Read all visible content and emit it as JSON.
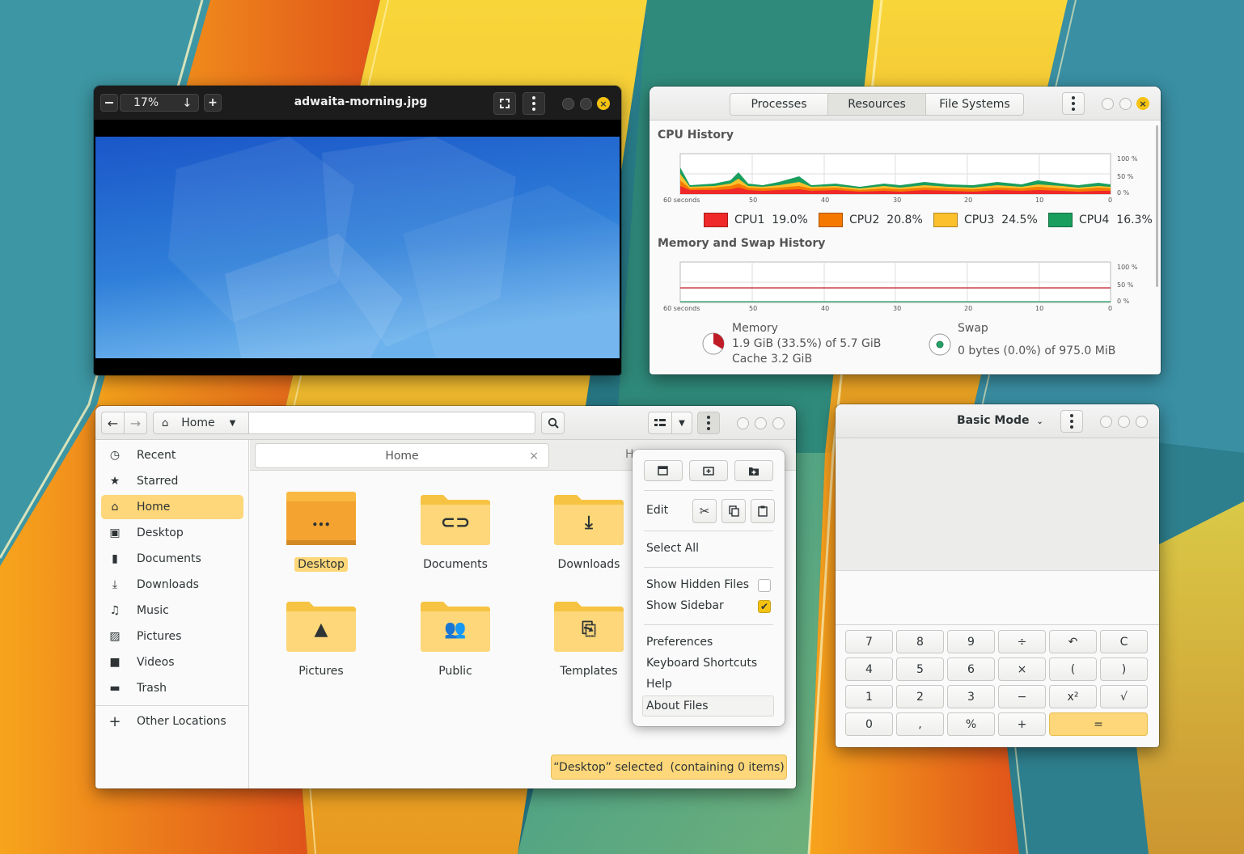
{
  "colors": {
    "accent": "#f5c211",
    "selection": "#fdd779",
    "cpu1": "#ef2929",
    "cpu2": "#f57900",
    "cpu3": "#fcc02d",
    "cpu4": "#1a9e5e",
    "memory": "#c01c28",
    "swap": "#26a269"
  },
  "viewer": {
    "zoom": "17%",
    "title": "adwaita-morning.jpg",
    "icons": {
      "zoom_out": "minus-icon",
      "zoom_menu": "arrow-down-icon",
      "zoom_in": "plus-icon",
      "fullscreen": "fullscreen-icon",
      "menu": "kebab-menu-icon",
      "close": "close-icon"
    }
  },
  "sysmon": {
    "tabs": [
      "Processes",
      "Resources",
      "File Systems"
    ],
    "active_tab": "Resources",
    "cpu": {
      "title": "CPU History",
      "yticks": [
        "100 %",
        "50 %",
        "0 %"
      ],
      "xticks": [
        "60 seconds",
        "50",
        "40",
        "30",
        "20",
        "10",
        "0"
      ],
      "legend": [
        {
          "name": "CPU1",
          "value": "19.0%"
        },
        {
          "name": "CPU2",
          "value": "20.8%"
        },
        {
          "name": "CPU3",
          "value": "24.5%"
        },
        {
          "name": "CPU4",
          "value": "16.3%"
        }
      ]
    },
    "mem": {
      "title": "Memory and Swap History",
      "yticks": [
        "100 %",
        "50 %",
        "0 %"
      ],
      "xticks": [
        "60 seconds",
        "50",
        "40",
        "30",
        "20",
        "10",
        "0"
      ],
      "memory_label": "Memory",
      "memory_value": "1.9 GiB (33.5%) of 5.7 GiB",
      "cache": "Cache 3.2 GiB",
      "memory_fraction": 0.335,
      "swap_label": "Swap",
      "swap_value": "0 bytes (0.0%) of 975.0 MiB",
      "swap_fraction": 0.0
    }
  },
  "files": {
    "path": "Home",
    "sidebar": [
      {
        "label": "Recent",
        "icon": "clock-icon"
      },
      {
        "label": "Starred",
        "icon": "star-icon"
      },
      {
        "label": "Home",
        "icon": "home-icon",
        "selected": true
      },
      {
        "label": "Desktop",
        "icon": "desktop-icon"
      },
      {
        "label": "Documents",
        "icon": "document-icon"
      },
      {
        "label": "Downloads",
        "icon": "download-icon"
      },
      {
        "label": "Music",
        "icon": "music-icon"
      },
      {
        "label": "Pictures",
        "icon": "picture-icon"
      },
      {
        "label": "Videos",
        "icon": "video-icon"
      },
      {
        "label": "Trash",
        "icon": "trash-icon"
      }
    ],
    "other_locations": "Other Locations",
    "tab_label": "Home",
    "tab2_partial": "H",
    "items": [
      {
        "label": "Desktop",
        "icon": "desktop-folder-icon",
        "selected": true
      },
      {
        "label": "Documents",
        "icon": "documents-folder-icon"
      },
      {
        "label": "Downloads",
        "icon": "downloads-folder-icon"
      },
      {
        "label": "Pictures",
        "icon": "pictures-folder-icon"
      },
      {
        "label": "Public",
        "icon": "public-folder-icon"
      },
      {
        "label": "Templates",
        "icon": "templates-folder-icon"
      }
    ],
    "status": "“Desktop” selected  (containing 0 items)",
    "menu": {
      "edit": "Edit",
      "select_all": "Select All",
      "show_hidden": "Show Hidden Files",
      "show_hidden_checked": false,
      "show_sidebar": "Show Sidebar",
      "show_sidebar_checked": true,
      "preferences": "Preferences",
      "shortcuts": "Keyboard Shortcuts",
      "help": "Help",
      "about": "About Files"
    }
  },
  "calc": {
    "mode": "Basic Mode",
    "keys": [
      [
        "7",
        "8",
        "9",
        "÷",
        "↶",
        "C"
      ],
      [
        "4",
        "5",
        "6",
        "×",
        "(",
        ")"
      ],
      [
        "1",
        "2",
        "3",
        "−",
        "x²",
        "√"
      ],
      [
        "0",
        ",",
        "%",
        "+",
        "="
      ]
    ]
  }
}
